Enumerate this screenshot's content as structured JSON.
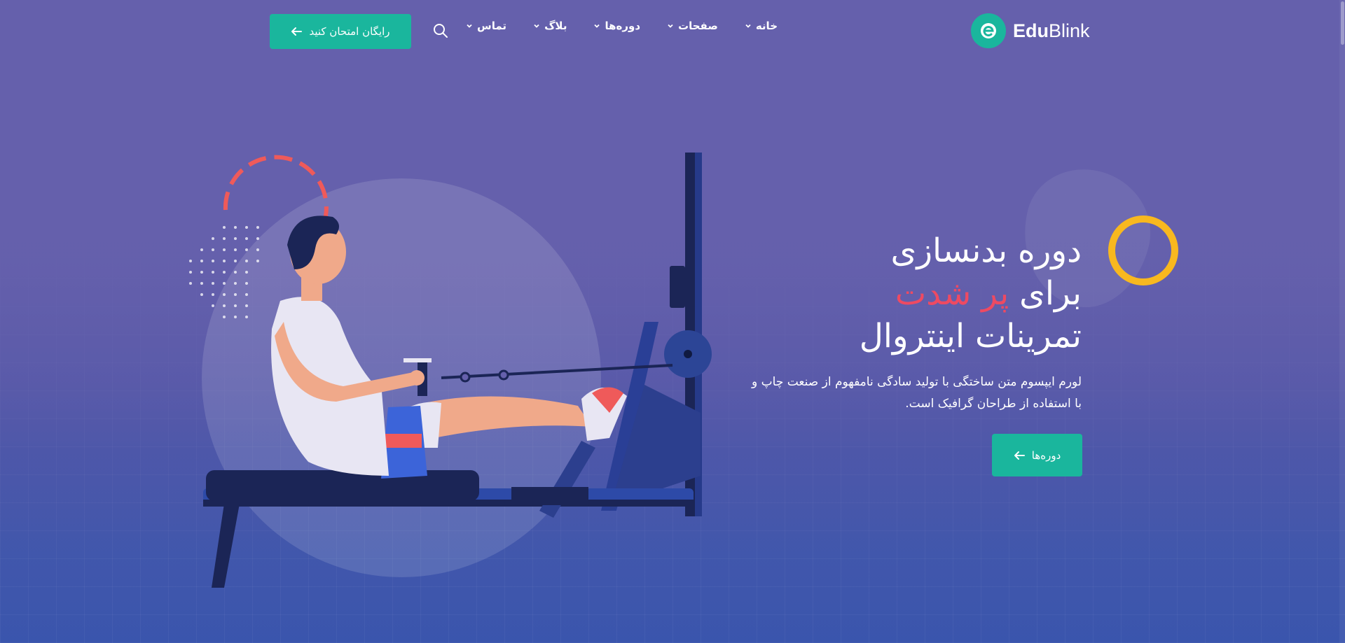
{
  "brand": {
    "name_bold": "Edu",
    "name_light": "Blink",
    "logo_letter": "e"
  },
  "nav": {
    "items": [
      {
        "label": "خانه"
      },
      {
        "label": "صفحات"
      },
      {
        "label": "دوره‌ها"
      },
      {
        "label": "بلاگ"
      },
      {
        "label": "تماس"
      }
    ]
  },
  "header": {
    "cta_label": "رایگان امتحان کنید"
  },
  "hero": {
    "title_line1": "دوره بدنسازی",
    "title_line2_prefix": "برای",
    "title_line2_accent": "پر شدت",
    "title_line3": "تمرینات اینتروال",
    "description_line1": "لورم ایپسوم متن ساختگی با تولید سادگی نامفهوم از صنعت چاپ و",
    "description_line2": "با استفاده از طراحان گرافیک است.",
    "button_label": "دوره‌ها"
  },
  "colors": {
    "background": "#6560ac",
    "primary": "#1ab69d",
    "accent": "#ee4a62",
    "ring": "#f8b81f"
  },
  "icons": {
    "search": "search-icon",
    "arrow": "arrow-left-icon",
    "chevron": "chevron-down-icon"
  }
}
